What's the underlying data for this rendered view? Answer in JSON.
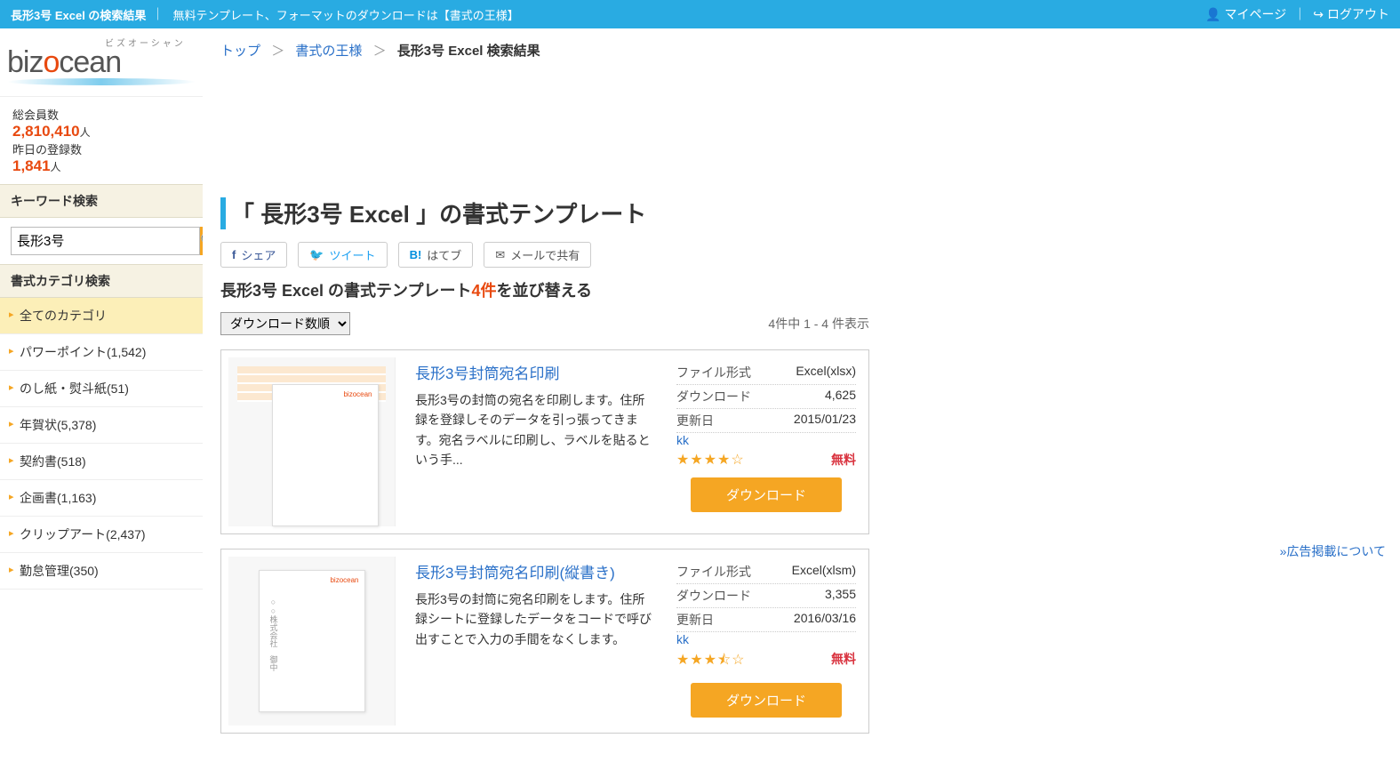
{
  "topbar": {
    "title": "長形3号 Excel の検索結果",
    "subtitle": "無料テンプレート、フォーマットのダウンロードは【書式の王様】",
    "mypage": "マイページ",
    "logout": "ログアウト"
  },
  "logo": {
    "jp": "ビズオーシャン",
    "main1": "biz",
    "main2": "cean"
  },
  "stats": {
    "members_label": "総会員数",
    "members_value": "2,810,410",
    "yesterday_label": "昨日の登録数",
    "yesterday_value": "1,841",
    "unit": "人"
  },
  "sidebar": {
    "keyword_h": "キーワード検索",
    "search_value": "長形3号",
    "category_h": "書式カテゴリ検索",
    "categories": [
      {
        "label": "全てのカテゴリ",
        "active": true
      },
      {
        "label": "パワーポイント(1,542)"
      },
      {
        "label": "のし紙・熨斗紙(51)"
      },
      {
        "label": "年賀状(5,378)"
      },
      {
        "label": "契約書(518)"
      },
      {
        "label": "企画書(1,163)"
      },
      {
        "label": "クリップアート(2,437)"
      },
      {
        "label": "勤怠管理(350)"
      }
    ]
  },
  "breadcrumb": {
    "top": "トップ",
    "king": "書式の王様",
    "current": "長形3号 Excel 検索結果"
  },
  "page": {
    "title": "「 長形3号 Excel 」の書式テンプレート",
    "sort_prefix": "長形3号 Excel の書式テンプレート",
    "sort_count": "4件",
    "sort_suffix": "を並び替える",
    "sort_select": "ダウンロード数順",
    "count_info": "4件中 1 - 4 件表示"
  },
  "share": {
    "fb": "シェア",
    "tw": "ツイート",
    "hb": "はてブ",
    "ml": "メールで共有",
    "hb_icon": "B!"
  },
  "results": [
    {
      "title": "長形3号封筒宛名印刷",
      "desc": "長形3号の封筒の宛名を印刷します。住所録を登録しそのデータを引っ張ってきます。宛名ラベルに印刷し、ラベルを貼るという手...",
      "format_k": "ファイル形式",
      "format_v": "Excel(xlsx)",
      "dl_k": "ダウンロード",
      "dl_v": "4,625",
      "date_k": "更新日",
      "date_v": "2015/01/23",
      "author": "kk",
      "stars": "★★★★☆",
      "price": "無料",
      "dl_btn": "ダウンロード"
    },
    {
      "title": "長形3号封筒宛名印刷(縦書き)",
      "desc": "長形3号の封筒に宛名印刷をします。住所録シートに登録したデータをコードで呼び出すことで入力の手間をなくします。",
      "format_k": "ファイル形式",
      "format_v": "Excel(xlsm)",
      "dl_k": "ダウンロード",
      "dl_v": "3,355",
      "date_k": "更新日",
      "date_v": "2016/03/16",
      "author": "kk",
      "stars": "★★★⯪☆",
      "price": "無料",
      "dl_btn": "ダウンロード"
    }
  ],
  "ad": {
    "link": "»広告掲載について"
  }
}
